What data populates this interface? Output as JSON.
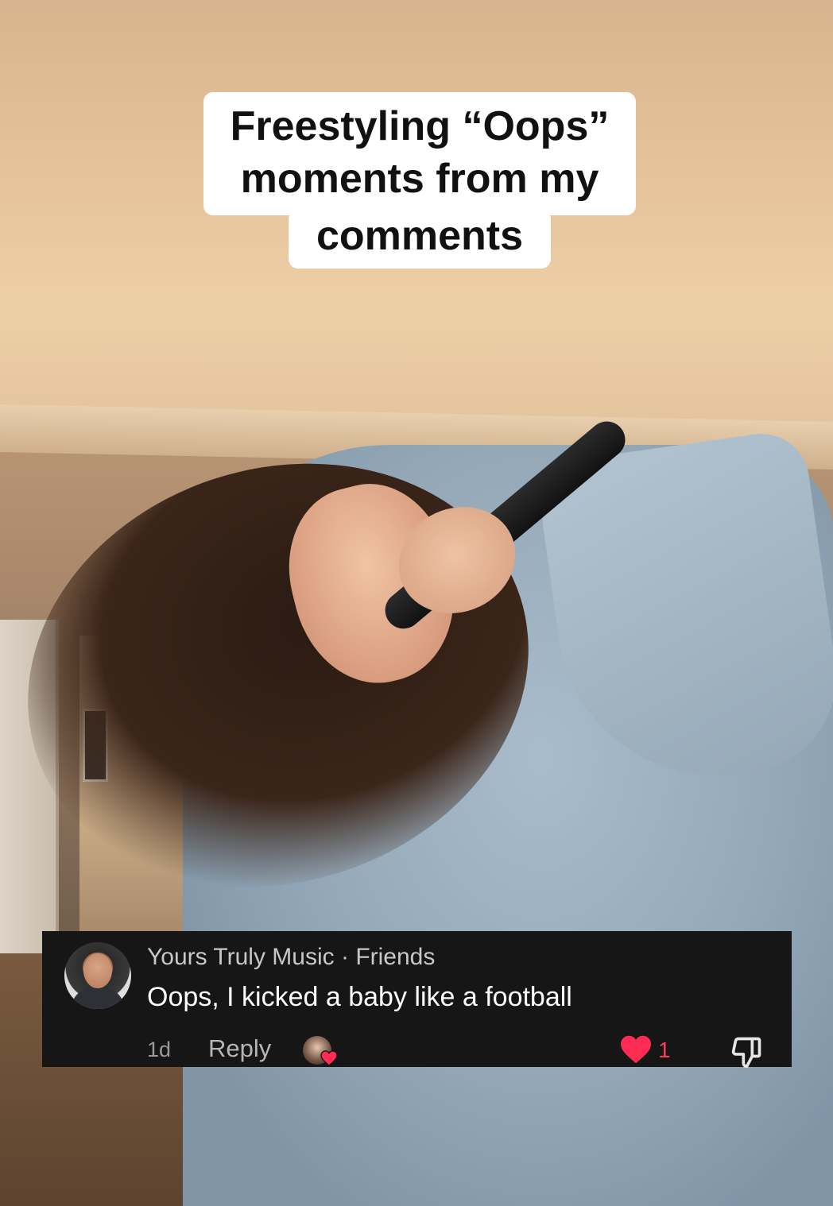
{
  "caption": {
    "lines": [
      "Freestyling “Oops”",
      "moments from my",
      "comments"
    ]
  },
  "comment": {
    "username": "Yours Truly Music",
    "separator": " · ",
    "relationship": "Friends",
    "text": "Oops, I kicked a baby like a football",
    "time": "1d",
    "reply_label": "Reply",
    "like_count": "1",
    "icons": {
      "avatar": "commenter-avatar",
      "creator_liked": "creator-liked-heart-icon",
      "like": "heart-icon",
      "dislike": "thumbs-down-icon"
    },
    "colors": {
      "card_bg": "#161616",
      "like": "#fe2c55"
    }
  }
}
